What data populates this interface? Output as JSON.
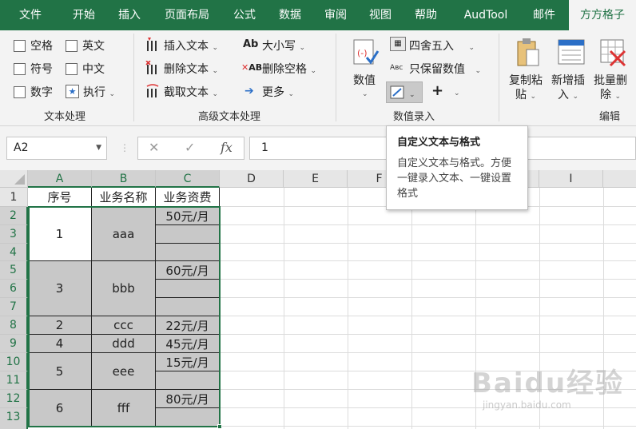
{
  "tabs": [
    "文件",
    "开始",
    "插入",
    "页面布局",
    "公式",
    "数据",
    "审阅",
    "视图",
    "帮助",
    "AudTool",
    "邮件",
    "方方格子"
  ],
  "active_tab": "方方格子",
  "ribbon": {
    "text_processing": {
      "checkboxes": [
        "空格",
        "英文",
        "符号",
        "中文",
        "数字"
      ],
      "execute": "执行",
      "label": "文本处理"
    },
    "advanced_text": {
      "insert_text": "插入文本",
      "delete_text": "删除文本",
      "cut_text": "截取文本",
      "case": "大小写",
      "delete_space": "删除空格",
      "more": "更多",
      "label": "高级文本处理"
    },
    "numeric_entry": {
      "value": "数值",
      "round": "四舍五入",
      "keep_numeric": "只保留数值",
      "label": "数值录入"
    },
    "edit": {
      "copy_paste_1": "复制粘",
      "copy_paste_2": "贴",
      "new_insert_1": "新增插",
      "new_insert_2": "入",
      "batch_delete_1": "批量删",
      "batch_delete_2": "除",
      "label": "编辑"
    }
  },
  "formula_bar": {
    "name_box": "A2",
    "cancel": "✕",
    "confirm": "✓",
    "fx": "fx",
    "value": "1"
  },
  "tooltip": {
    "title": "自定义文本与格式",
    "body": "自定义文本与格式。方便一键录入文本、一键设置格式"
  },
  "sheet": {
    "columns": [
      "A",
      "B",
      "C",
      "D",
      "E",
      "F",
      "G",
      "H",
      "I"
    ],
    "rows": [
      "1",
      "2",
      "3",
      "4",
      "5",
      "6",
      "7",
      "8",
      "9",
      "10",
      "11",
      "12",
      "13"
    ],
    "headers": [
      "序号",
      "业务名称",
      "业务资费"
    ],
    "records": [
      {
        "no": "1",
        "name": "aaa",
        "fee": "50元/月"
      },
      {
        "no": "3",
        "name": "bbb",
        "fee": "60元/月"
      },
      {
        "no": "2",
        "name": "ccc",
        "fee": "22元/月"
      },
      {
        "no": "4",
        "name": "ddd",
        "fee": "45元/月"
      },
      {
        "no": "5",
        "name": "eee",
        "fee": "15元/月"
      },
      {
        "no": "6",
        "name": "fff",
        "fee": "80元/月"
      }
    ]
  },
  "watermark": {
    "brand": "Baidu经验",
    "url": "jingyan.baidu.com"
  },
  "colors": {
    "accent": "#217346",
    "fill_gray": "#c8c8c8"
  }
}
